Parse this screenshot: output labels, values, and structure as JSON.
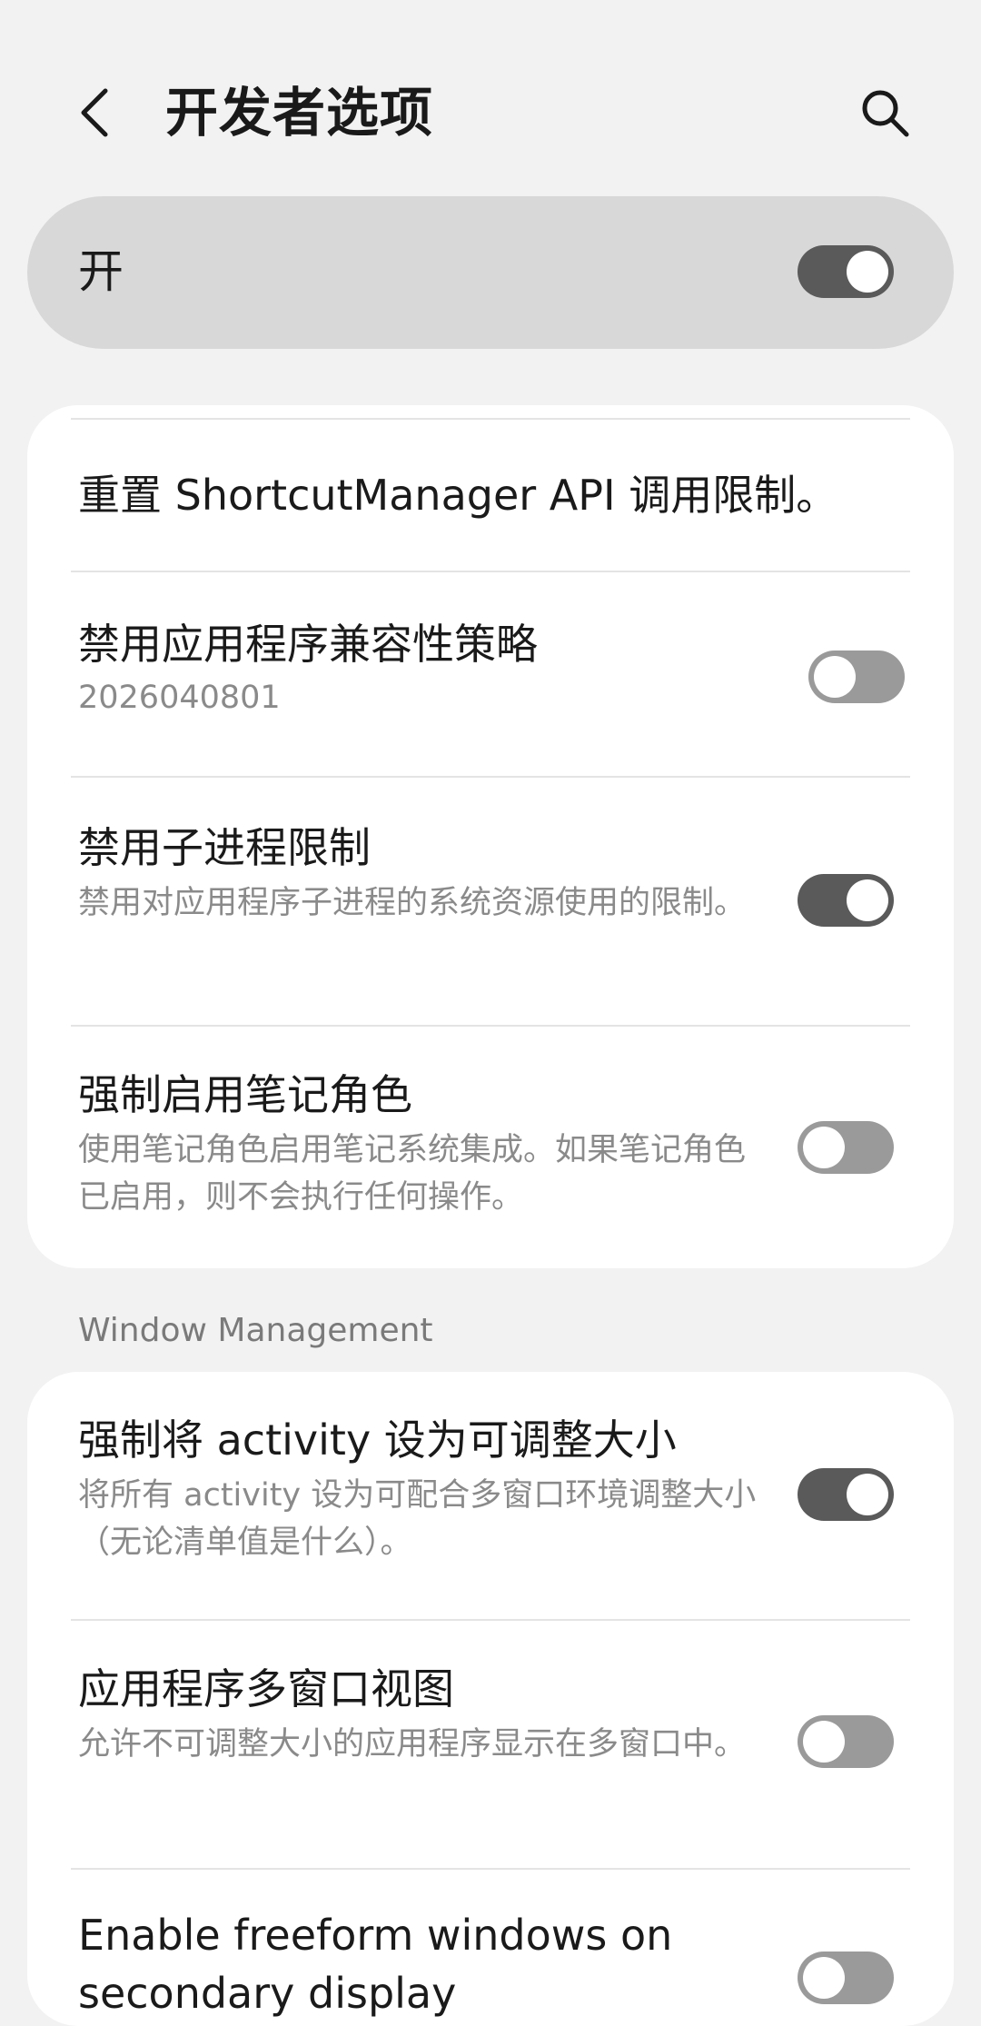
{
  "header": {
    "title": "开发者选项"
  },
  "master": {
    "label": "开",
    "on": true
  },
  "card1": {
    "items": [
      {
        "title": "重置 ShortcutManager API 调用限制。"
      },
      {
        "title": "禁用应用程序兼容性策略",
        "summary": "2026040801",
        "on": false
      },
      {
        "title": "禁用子进程限制",
        "summary": "禁用对应用程序子进程的系统资源使用的限制。",
        "on": true
      },
      {
        "title": "强制启用笔记角色",
        "summary": "使用笔记角色启用笔记系统集成。如果笔记角色已启用，则不会执行任何操作。",
        "on": false
      }
    ]
  },
  "section": {
    "window_management": "Window Management"
  },
  "card2": {
    "items": [
      {
        "title": "强制将 activity 设为可调整大小",
        "summary": "将所有 activity 设为可配合多窗口环境调整大小（无论清单值是什么）。",
        "on": true
      },
      {
        "title": "应用程序多窗口视图",
        "summary": "允许不可调整大小的应用程序显示在多窗口中。",
        "on": false
      },
      {
        "title": "Enable freeform windows on secondary display",
        "on": false
      }
    ]
  },
  "colors": {
    "background": "#f2f2f2",
    "card": "#ffffff",
    "master_bar": "#d8d8d8",
    "toggle_on": "#5a5a5a",
    "toggle_off": "#9a9a9a",
    "summary_text": "#8a8a8a"
  },
  "icons": {
    "back": "chevron-left-icon",
    "search": "search-icon"
  }
}
